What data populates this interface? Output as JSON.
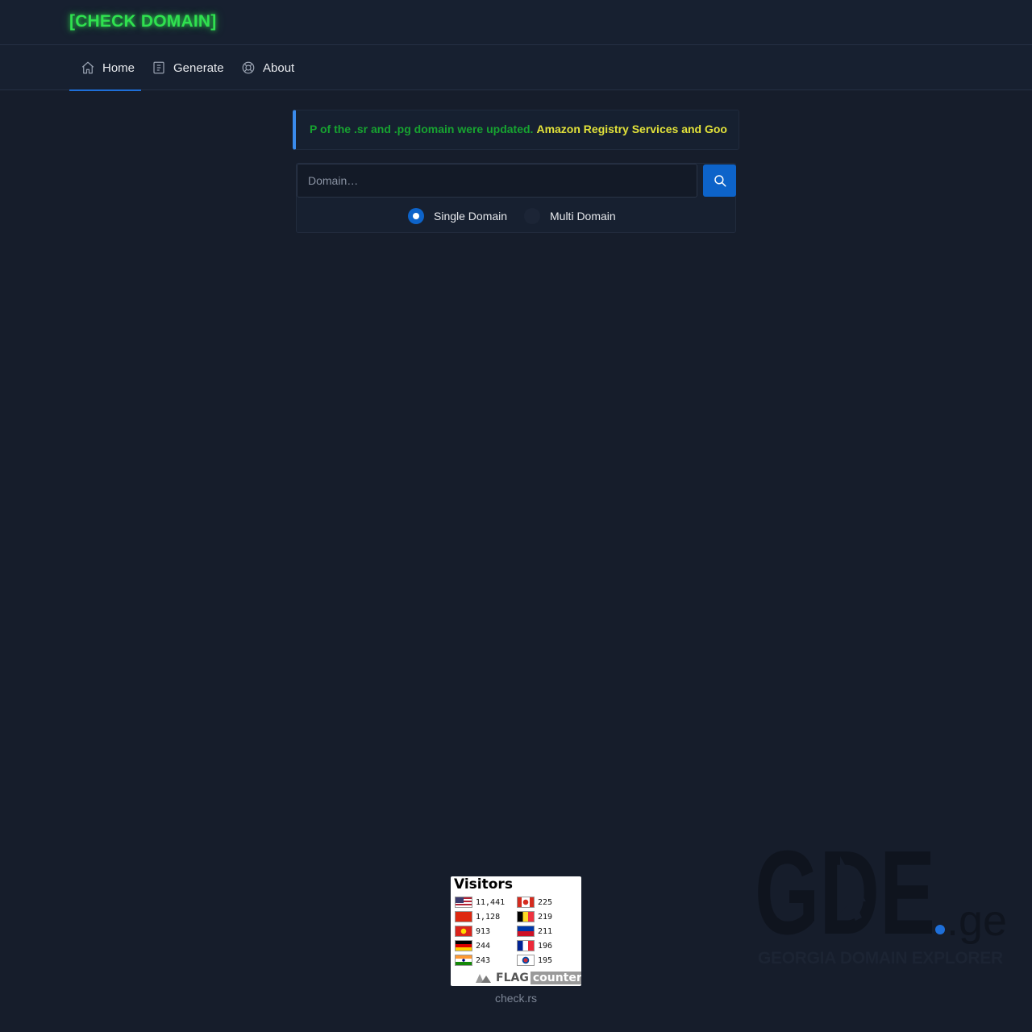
{
  "brand": {
    "title": "[CHECK DOMAIN]",
    "color": "#2fe14f"
  },
  "nav": {
    "items": [
      {
        "label": "Home",
        "icon": "home-icon",
        "active": true
      },
      {
        "label": "Generate",
        "icon": "document-icon",
        "active": false
      },
      {
        "label": "About",
        "icon": "lifebuoy-icon",
        "active": false
      }
    ]
  },
  "notice": {
    "green_text": "P of the .sr and .pg domain were updated.",
    "yellow_text": "Amazon Registry Services and Goo"
  },
  "search": {
    "placeholder": "Domain…",
    "button_icon": "search-icon",
    "modes": [
      {
        "label": "Single Domain",
        "selected": true
      },
      {
        "label": "Multi Domain",
        "selected": false
      }
    ]
  },
  "flag_counter": {
    "title": "Visitors",
    "left_column": [
      {
        "flag": "us-flag",
        "count": "11,441"
      },
      {
        "flag": "cn-flag",
        "count": "1,128"
      },
      {
        "flag": "vn-flag",
        "count": "913"
      },
      {
        "flag": "de-flag",
        "count": "244"
      },
      {
        "flag": "in-flag",
        "count": "243"
      }
    ],
    "right_column": [
      {
        "flag": "ca-flag",
        "count": "225"
      },
      {
        "flag": "be-flag",
        "count": "219"
      },
      {
        "flag": "ph-flag",
        "count": "211"
      },
      {
        "flag": "fr-flag",
        "count": "196"
      },
      {
        "flag": "kr-flag",
        "count": "195"
      }
    ],
    "logo_flag": "FLAG",
    "logo_counter": "counter",
    "caption": "check.rs"
  },
  "gde": {
    "letters": "GDE",
    "suffix": ".ge",
    "tagline": "GEORGIA DOMAIN EXPLORER"
  },
  "colors": {
    "accent": "#0d63c9",
    "background": "#161d2b",
    "notice_border": "#3a8bec"
  }
}
